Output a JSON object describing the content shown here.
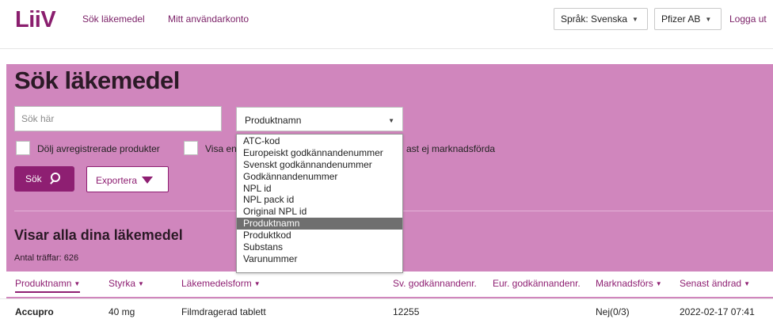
{
  "header": {
    "logo": "LiiV",
    "nav": [
      "Sök läkemedel",
      "Mitt användarkonto"
    ],
    "language_label": "Språk: Svenska",
    "org_label": "Pfizer AB",
    "logout_label": "Logga ut"
  },
  "search": {
    "title": "Sök läkemedel",
    "input_placeholder": "Sök här",
    "input_value": "",
    "field_select": {
      "selected": "Produktnamn",
      "options": [
        "ATC-kod",
        "Europeiskt godkännandenummer",
        "Svenskt godkännandenummer",
        "Godkännandenummer",
        "NPL id",
        "NPL pack id",
        "Original NPL id",
        "Produktnamn",
        "Produktkod",
        "Substans",
        "Varunummer"
      ],
      "highlighted_index": 7
    },
    "checkboxes": [
      {
        "label": "Dölj avregistrerade produkter",
        "checked": false
      },
      {
        "label": "Visa en",
        "checked": false
      }
    ],
    "checkbox3_visible_text": "ast ej marknadsförda",
    "search_button": "Sök",
    "export_button": "Exportera"
  },
  "results": {
    "title": "Visar alla dina läkemedel",
    "hits_label": "Antal träffar: 626",
    "columns": [
      {
        "label": "Produktnamn",
        "sortable": true,
        "active": true
      },
      {
        "label": "Styrka",
        "sortable": true,
        "active": false
      },
      {
        "label": "Läkemedelsform",
        "sortable": true,
        "active": false
      },
      {
        "label": "Sv. godkännandenr.",
        "sortable": false,
        "active": false
      },
      {
        "label": "Eur. godkännandenr.",
        "sortable": false,
        "active": false
      },
      {
        "label": "Marknadsförs",
        "sortable": true,
        "active": false
      },
      {
        "label": "Senast ändrad",
        "sortable": true,
        "active": false
      }
    ],
    "rows": [
      {
        "name": "Accupro",
        "strength": "40 mg",
        "form": "Filmdragerad tablett",
        "sv_nr": "12255",
        "eur_nr": "",
        "marketed": "Nej(0/3)",
        "changed": "2022-02-17 07:41"
      }
    ]
  },
  "colors": {
    "brand": "#8e1f72",
    "panel": "#d086bd",
    "highlight": "#6f6f6f"
  }
}
